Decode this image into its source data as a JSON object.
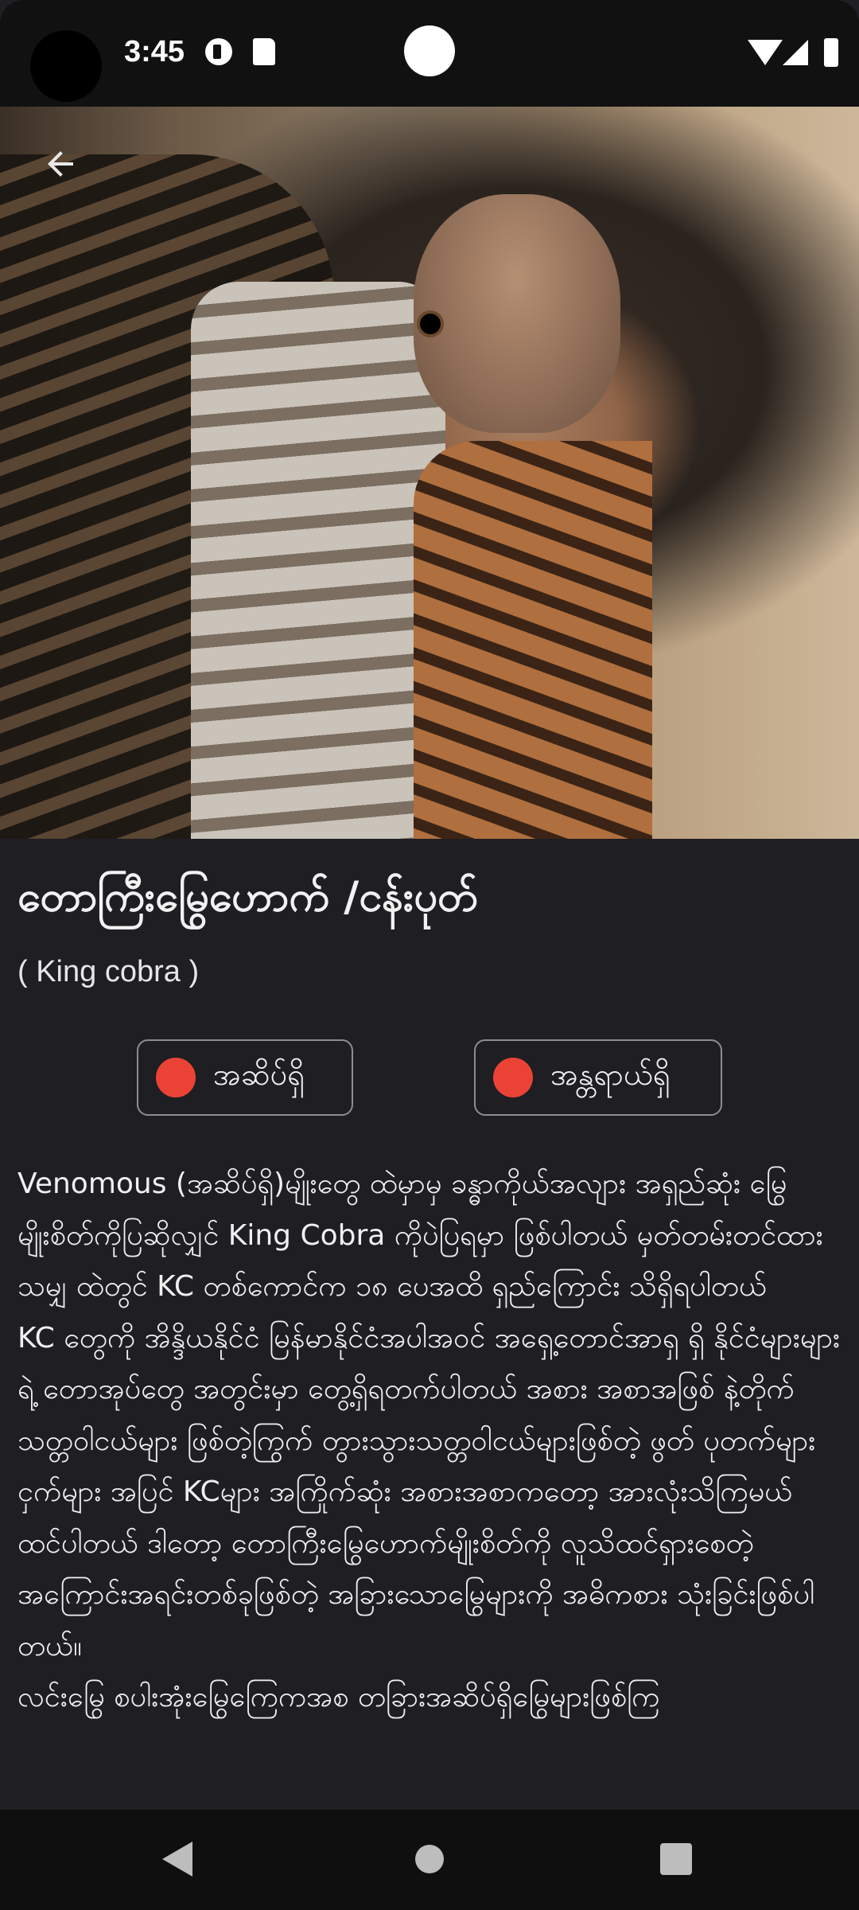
{
  "status_bar": {
    "time": "3:45",
    "icons": [
      "vpn-key-icon",
      "sd-card-icon",
      "wifi-icon",
      "signal-icon",
      "battery-icon"
    ]
  },
  "hero": {
    "image": "king-cobra-photo",
    "back_icon": "arrow-left-icon"
  },
  "content": {
    "title": "တောကြီးမြွေဟောက် /ငန်းပုတ်",
    "subtitle": "( King cobra )",
    "tags": [
      {
        "label": "အဆိပ်ရှိ",
        "dot_color": "#ea4335"
      },
      {
        "label": "အန္တရာယ်ရှိ",
        "dot_color": "#ea4335"
      }
    ],
    "description": "   Venomous (အဆိပ်ရှိ)မျိုးတွေ ထဲမှာမှ ခန္ဓာကိုယ်အလျား အရှည်ဆုံး မြွေမျိုးစိတ်ကိုပြဆိုလျှင် King Cobra ကိုပဲပြရမှာ ဖြစ်ပါတယ် မှတ်တမ်းတင်ထားသမျှ ထဲတွင် KC တစ်ကောင်က ၁၈ ပေအထိ ရှည်ကြောင်း သိရှိရပါတယ်\nKC တွေကို အိန္ဒိယနိုင်ငံ မြန်မာနိုင်ငံအပါအဝင် အရှေ့တောင်အာရှ ရှိ နိုင်ငံများများရဲ့ တောအုပ်တွေ အတွင်းမှာ တွေ့ရှိရတက်ပါတယ် အစား အစာအဖြစ် နဲ့တိုက်သတ္တဝါငယ်များ ဖြစ်တဲ့ကြွက် တွားသွားသတ္တဝါငယ်များဖြစ်တဲ့ ဖွတ် ပုတက်များ ငှက်များ အပြင် KCများ အကြိုက်ဆုံး အစားအစာကတော့ အားလုံးသိကြမယ် ထင်ပါတယ် ဒါတော့ တောကြီးမြွေဟောက်မျိုးစိတ်ကို လူသိထင်ရှားစေတဲ့ အကြောင်းအရင်းတစ်ခုဖြစ်တဲ့ အခြားသောမြွေများကို အဓိကစား သုံးခြင်းဖြစ်ပါတယ်။\nလင်းမြွေ စပါးအုံးမြွေကြေကအစ တခြားအဆိပ်ရှိမြွေများဖြစ်ကြ"
  },
  "nav_bar": {
    "icons": [
      "nav-back-icon",
      "nav-home-icon",
      "nav-recents-icon"
    ]
  }
}
